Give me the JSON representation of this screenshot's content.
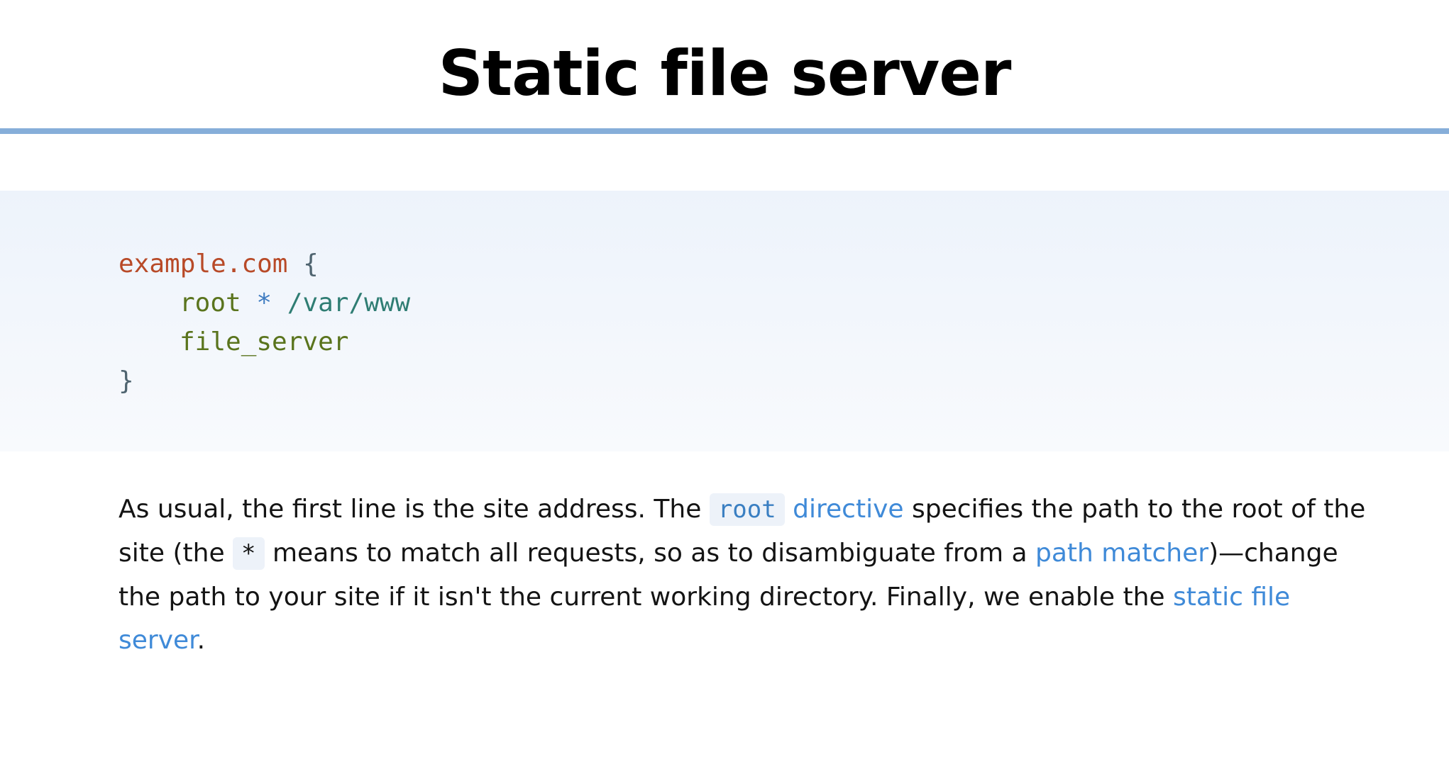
{
  "page": {
    "title": "Static file server"
  },
  "code": {
    "line1": {
      "site": "example.com",
      "open": " {"
    },
    "line2": {
      "directive": "root",
      "matcher": "*",
      "path": "/var/www"
    },
    "line3": {
      "directive": "file_server"
    },
    "line4": {
      "close": "}"
    }
  },
  "paragraph": {
    "t1": "As usual, the first line is the site address. The ",
    "code_root": "root",
    "link_directive": "directive",
    "t2": " specifies the path to the root of the site (the ",
    "code_star": "*",
    "t3": " means to match all requests, so as to disambiguate from a ",
    "link_path_matcher": "path matcher",
    "t4": ")—change the path to your site if it isn't the current working directory. Finally, we enable the ",
    "link_static_file_server": "static file server",
    "t5": "."
  },
  "colors": {
    "title_rule": "#86aed9",
    "code_background": "#edf3fb",
    "link": "#3f8ad8",
    "site_token": "#b84a28",
    "directive_token": "#5a741d",
    "matcher_token": "#3f7cc1",
    "path_token": "#2f7d73"
  }
}
